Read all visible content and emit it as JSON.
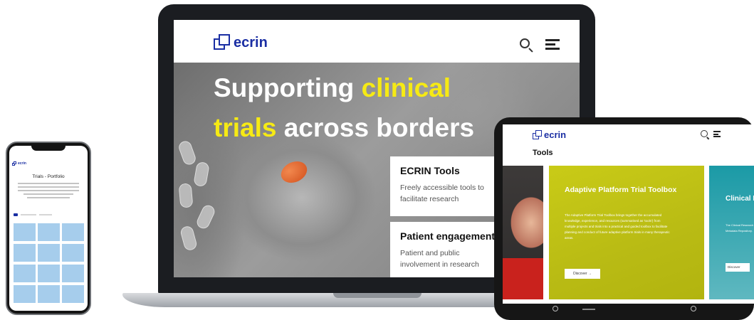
{
  "laptop": {
    "logo_text": "ecrin",
    "hero": {
      "line1_plain": "Supporting ",
      "line1_highlight": "clinical",
      "line2_highlight": "trials",
      "line2_plain": " across borders"
    },
    "cards": [
      {
        "title": "ECRIN Tools",
        "description": "Freely accessible tools to facilitate research"
      },
      {
        "title": "Patient engagement",
        "description": "Patient and public involvement in research"
      }
    ]
  },
  "phone": {
    "logo_text": "ecrin",
    "page_title": "Trials - Portfolio"
  },
  "tablet": {
    "logo_text": "ecrin",
    "page_title": "Tools",
    "featured_card": {
      "title": "Adaptive Platform Trial Toolbox",
      "description": "The Adaptive Platform Trial Toolbox brings together the accumulated knowledge, experience, and resources (summarised as 'tools') from multiple projects and trials into a practical and guided toolbox to facilitate planning and conduct of future adaptive platform trials in many therapeutic areas.",
      "button_label": "Discover →"
    },
    "next_card": {
      "title": "Clinical Repository",
      "description": "The Clinical Research Metadata Repository.",
      "button_label": "Discover"
    }
  },
  "colors": {
    "brand_blue": "#1a2ea3",
    "highlight_yellow": "#f6ea14",
    "tool_card_olive": "#c9cb17",
    "tool_card_teal": "#1b9aa6",
    "portfolio_tile": "#a6cdec"
  }
}
